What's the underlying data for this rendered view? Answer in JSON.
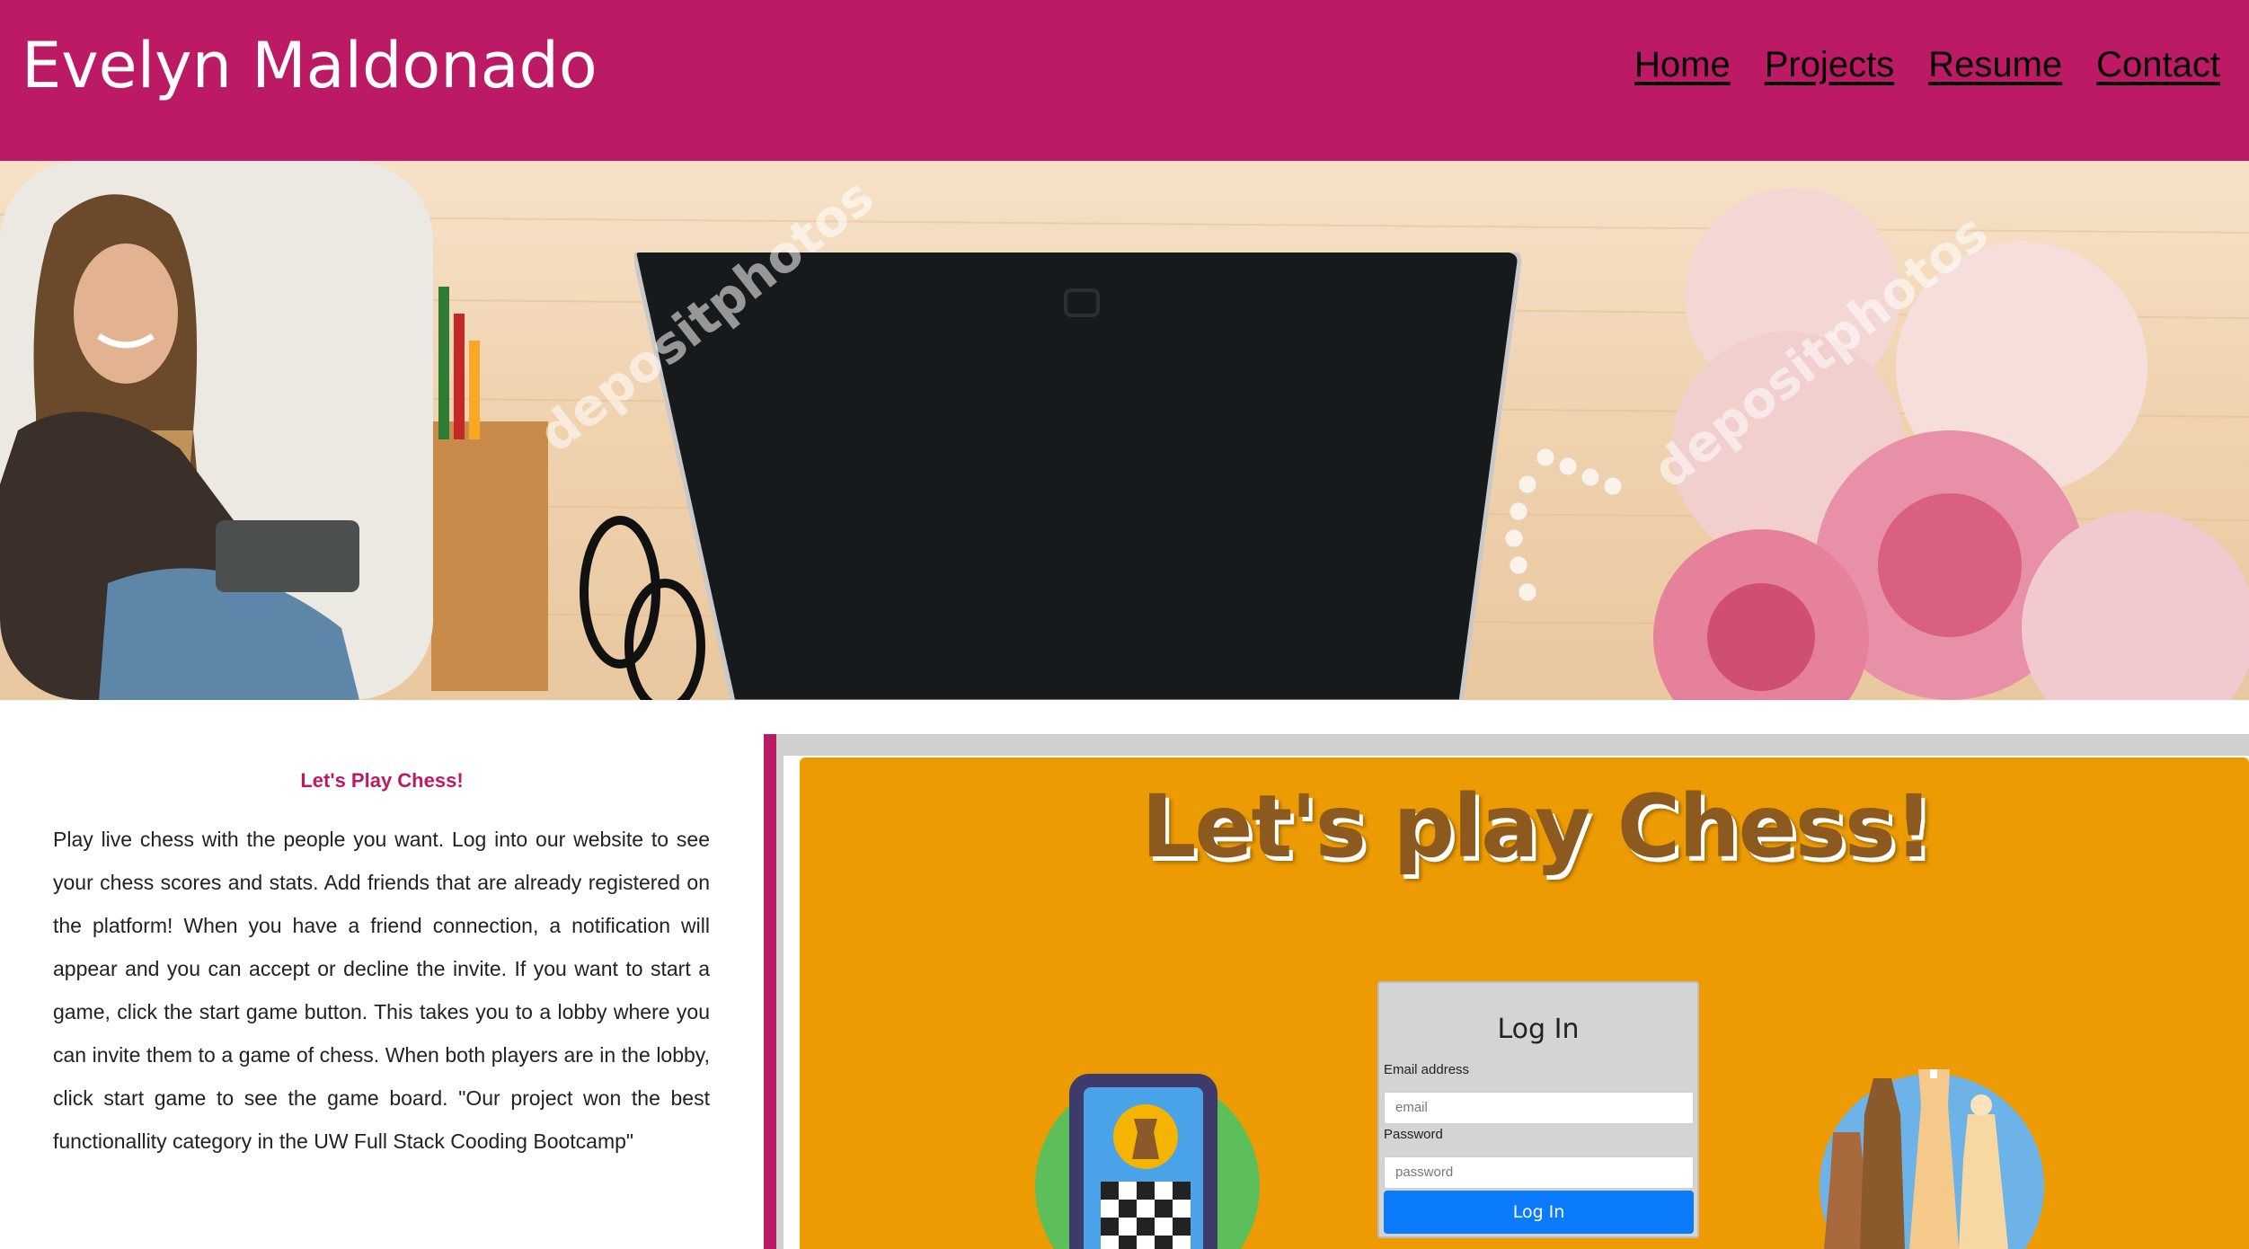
{
  "header": {
    "title": "Evelyn Maldonado",
    "nav": [
      "Home",
      "Projects",
      "Resume",
      "Contact"
    ]
  },
  "hero": {
    "watermark": "depositphotos"
  },
  "project": {
    "title": "Let's Play Chess!",
    "description": "Play live chess with the people you want. Log into our website to see your chess scores and stats. Add friends that are already registered on the platform! When you have a friend connection, a notification will appear and you can accept or decline the invite. If you want to start a game, click the start game button. This takes you to a lobby where you can invite them to a game of chess. When both players are in the lobby, click start game to see the game board. \"Our project won the best functionallity category in the UW Full Stack Cooding Bootcamp\""
  },
  "preview": {
    "heading": "Let's play Chess!",
    "login": {
      "title": "Log In",
      "email_label": "Email address",
      "email_placeholder": "email",
      "password_label": "Password",
      "password_placeholder": "password",
      "button": "Log In"
    }
  },
  "colors": {
    "brand": "#bc1a64",
    "preview_background": "#ec9b03",
    "login_button": "#0a7cfb"
  }
}
